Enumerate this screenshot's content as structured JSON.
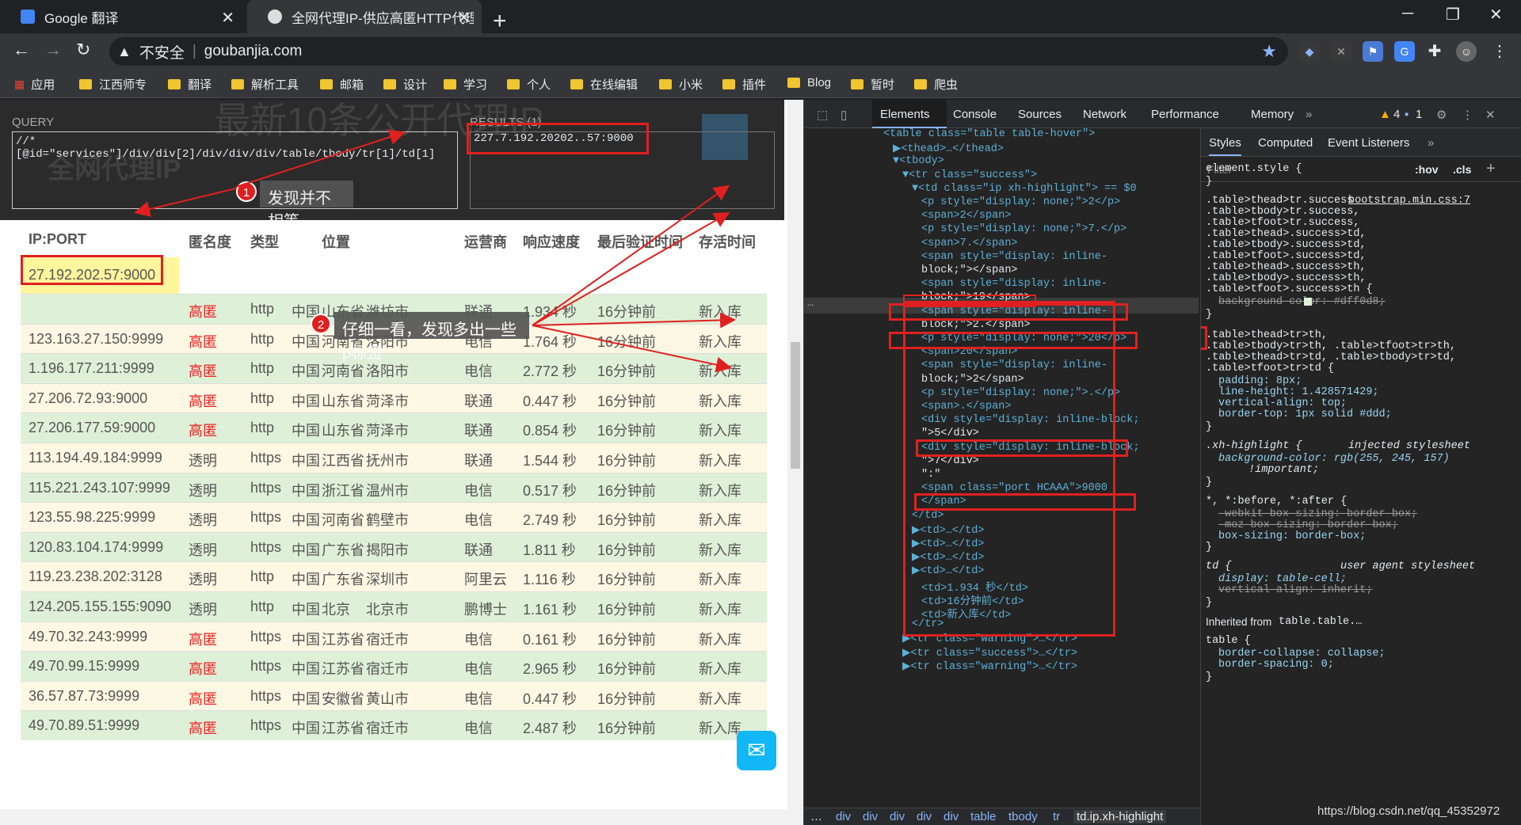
{
  "tabs": [
    {
      "title": "Google 翻译",
      "favicon": "google-translate-icon"
    },
    {
      "title": "全网代理IP-供应高匿HTTP代理I",
      "favicon": "globe-icon"
    }
  ],
  "address": {
    "security": "不安全",
    "url": "goubanjia.com"
  },
  "bookmarks": [
    {
      "label": "应用",
      "icon": "apps-grid-icon"
    },
    {
      "label": "江西师专"
    },
    {
      "label": "翻译"
    },
    {
      "label": "解析工具"
    },
    {
      "label": "邮箱"
    },
    {
      "label": "设计"
    },
    {
      "label": "学习"
    },
    {
      "label": "个人"
    },
    {
      "label": "在线编辑"
    },
    {
      "label": "小米"
    },
    {
      "label": "插件"
    },
    {
      "label": "Blog"
    },
    {
      "label": "暂时"
    },
    {
      "label": "爬虫"
    }
  ],
  "xpath_helper": {
    "query_label": "QUERY",
    "query": "//*[@id=\"services\"]/div/div[2]/div/div/div/table/tbody/tr[1]/td[1]",
    "results_label": "RESULTS (1)",
    "result": "227.7.192.20202..57:9000"
  },
  "page_bg": {
    "title": "最新10条公开代理IP",
    "logo": "全网代理IP"
  },
  "table": {
    "headers": [
      "IP:PORT",
      "匿名度",
      "类型",
      "位置",
      "运营商",
      "响应速度",
      "最后验证时间",
      "存活时间"
    ],
    "rows": [
      {
        "ip": "27.192.202.57:9000",
        "anon": "高匿",
        "type": "http",
        "country": "中国",
        "prov": "山东省",
        "city": "潍坊市",
        "isp": "联通",
        "speed": "1.934 秒",
        "verify": "16分钟前",
        "alive": "新入库",
        "cls": "success"
      },
      {
        "ip": "123.163.27.150:9999",
        "anon": "高匿",
        "type": "http",
        "country": "中国",
        "prov": "河南省",
        "city": "洛阳市",
        "isp": "电信",
        "speed": "1.764 秒",
        "verify": "16分钟前",
        "alive": "新入库",
        "cls": "warning"
      },
      {
        "ip": "1.196.177.211:9999",
        "anon": "高匿",
        "type": "http",
        "country": "中国",
        "prov": "河南省",
        "city": "洛阳市",
        "isp": "电信",
        "speed": "2.772 秒",
        "verify": "16分钟前",
        "alive": "新入库",
        "cls": "success"
      },
      {
        "ip": "27.206.72.93:9000",
        "anon": "高匿",
        "type": "http",
        "country": "中国",
        "prov": "山东省",
        "city": "菏泽市",
        "isp": "联通",
        "speed": "0.447 秒",
        "verify": "16分钟前",
        "alive": "新入库",
        "cls": "warning"
      },
      {
        "ip": "27.206.177.59:9000",
        "anon": "高匿",
        "type": "http",
        "country": "中国",
        "prov": "山东省",
        "city": "菏泽市",
        "isp": "联通",
        "speed": "0.854 秒",
        "verify": "16分钟前",
        "alive": "新入库",
        "cls": "success"
      },
      {
        "ip": "113.194.49.184:9999",
        "anon": "透明",
        "type": "https",
        "country": "中国",
        "prov": "江西省",
        "city": "抚州市",
        "isp": "联通",
        "speed": "1.544 秒",
        "verify": "16分钟前",
        "alive": "新入库",
        "cls": "warning"
      },
      {
        "ip": "115.221.243.107:9999",
        "anon": "透明",
        "type": "https",
        "country": "中国",
        "prov": "浙江省",
        "city": "温州市",
        "isp": "电信",
        "speed": "0.517 秒",
        "verify": "16分钟前",
        "alive": "新入库",
        "cls": "success"
      },
      {
        "ip": "123.55.98.225:9999",
        "anon": "透明",
        "type": "https",
        "country": "中国",
        "prov": "河南省",
        "city": "鹤壁市",
        "isp": "电信",
        "speed": "2.749 秒",
        "verify": "16分钟前",
        "alive": "新入库",
        "cls": "warning"
      },
      {
        "ip": "120.83.104.174:9999",
        "anon": "透明",
        "type": "https",
        "country": "中国",
        "prov": "广东省",
        "city": "揭阳市",
        "isp": "联通",
        "speed": "1.811 秒",
        "verify": "16分钟前",
        "alive": "新入库",
        "cls": "success"
      },
      {
        "ip": "119.23.238.202:3128",
        "anon": "透明",
        "type": "http",
        "country": "中国",
        "prov": "广东省",
        "city": "深圳市",
        "isp": "阿里云",
        "speed": "1.116 秒",
        "verify": "16分钟前",
        "alive": "新入库",
        "cls": "warning"
      },
      {
        "ip": "124.205.155.155:9090",
        "anon": "透明",
        "type": "http",
        "country": "中国",
        "prov": "北京",
        "city": "北京市",
        "isp": "鹏博士",
        "speed": "1.161 秒",
        "verify": "16分钟前",
        "alive": "新入库",
        "cls": "success"
      },
      {
        "ip": "49.70.32.243:9999",
        "anon": "高匿",
        "type": "https",
        "country": "中国",
        "prov": "江苏省",
        "city": "宿迁市",
        "isp": "电信",
        "speed": "0.161 秒",
        "verify": "16分钟前",
        "alive": "新入库",
        "cls": "warning"
      },
      {
        "ip": "49.70.99.15:9999",
        "anon": "高匿",
        "type": "https",
        "country": "中国",
        "prov": "江苏省",
        "city": "宿迁市",
        "isp": "电信",
        "speed": "2.965 秒",
        "verify": "16分钟前",
        "alive": "新入库",
        "cls": "success"
      },
      {
        "ip": "36.57.87.73:9999",
        "anon": "高匿",
        "type": "https",
        "country": "中国",
        "prov": "安徽省",
        "city": "黄山市",
        "isp": "电信",
        "speed": "0.447 秒",
        "verify": "16分钟前",
        "alive": "新入库",
        "cls": "warning"
      },
      {
        "ip": "49.70.89.51:9999",
        "anon": "高匿",
        "type": "https",
        "country": "中国",
        "prov": "江苏省",
        "city": "宿迁市",
        "isp": "电信",
        "speed": "2.487 秒",
        "verify": "16分钟前",
        "alive": "新入库",
        "cls": "success"
      }
    ]
  },
  "callouts": [
    {
      "num": "1",
      "text": "发现并不相等"
    },
    {
      "num": "2",
      "text": "仔细一看，发现多出一些p标签"
    }
  ],
  "devtools": {
    "tabs": [
      "Elements",
      "Console",
      "Sources",
      "Network",
      "Performance",
      "Memory"
    ],
    "warn_count": "4",
    "info_count": "1",
    "dom_lines": [
      "<table class=\"table table-hover\">",
      "▶<thead>…</thead>",
      "▼<tbody>",
      "▼<tr class=\"success\">",
      "▼<td class=\"ip xh-highlight\"> == $0",
      "<p style=\"display: none;\">2</p>",
      "<span>2</span>",
      "<p style=\"display: none;\">7.</p>",
      "<span>7.</span>",
      "<span style=\"display: inline-",
      "block;\"></span>",
      "<span style=\"display: inline-",
      "block;\">19</span>",
      "<span style=\"display: inline-",
      "block;\">2.</span>",
      "<p style=\"display: none;\">20</p>",
      "<span>20</span>",
      "<span style=\"display: inline-",
      "block;\">2</span>",
      "<p style=\"display: none;\">.</p>",
      "<span>.</span>",
      "<div style=\"display: inline-block;",
      "\">5</div>",
      "<div style=\"display: inline-block;",
      "\">7</div>",
      "\":\"",
      "<span class=\"port HCAAA\">9000",
      "</span>",
      "</td>",
      "▶<td>…</td>",
      "▶<td>…</td>",
      "▶<td>…</td>",
      "▶<td>…</td>",
      "<td>1.934 秒</td>",
      "<td>16分钟前</td>",
      "<td>新入库</td>",
      "</tr>",
      "▶<tr class=\"warning\">…</tr>",
      "▶<tr class=\"success\">…</tr>",
      "▶<tr class=\"warning\">…</tr>"
    ],
    "breadcrumb": [
      "…",
      "div",
      "div",
      "div",
      "div",
      "div",
      "table",
      "tbody",
      "tr",
      "td.ip.xh-highlight"
    ],
    "styles_tabs": [
      "Styles",
      "Computed",
      "Event Listeners"
    ],
    "filter_placeholder": "Filter",
    "hov": ":hov",
    "cls": ".cls",
    "style_lines": [
      "element.style {",
      "}",
      ".table>thead>tr.success",
      "bootstrap.min.css:7",
      ".table>tbody>tr.success,",
      ".table>tfoot>tr.success,",
      ".table>thead>.success>td,",
      ".table>tbody>.success>td,",
      ".table>tfoot>.success>td,",
      ".table>thead>.success>th,",
      ".table>tbody>.success>th,",
      ".table>tfoot>.success>th {",
      "background-color: #dff0d8;",
      "}",
      ".table>thead>tr>th,",
      ".table>tbody>tr>th, .table>tfoot>tr>th,",
      ".table>thead>tr>td, .table>tbody>tr>td,",
      ".table>tfoot>tr>td {",
      "padding: 8px;",
      "line-height: 1.428571429;",
      "vertical-align: top;",
      "border-top: 1px solid #ddd;",
      "}",
      ".xh-highlight {",
      "injected stylesheet",
      "background-color: rgb(255, 245, 157)",
      "!important;",
      "}",
      "*, *:before, *:after {",
      "-webkit-box-sizing: border-box;",
      "-moz-box-sizing: border-box;",
      "box-sizing: border-box;",
      "}",
      "td {",
      "user agent stylesheet",
      "display: table-cell;",
      "vertical-align: inherit;",
      "}",
      "Inherited from",
      "table.table.…",
      "table {",
      "border-collapse: collapse;",
      "border-spacing: 0;",
      "}"
    ]
  },
  "watermark": "https://blog.csdn.net/qq_45352972"
}
